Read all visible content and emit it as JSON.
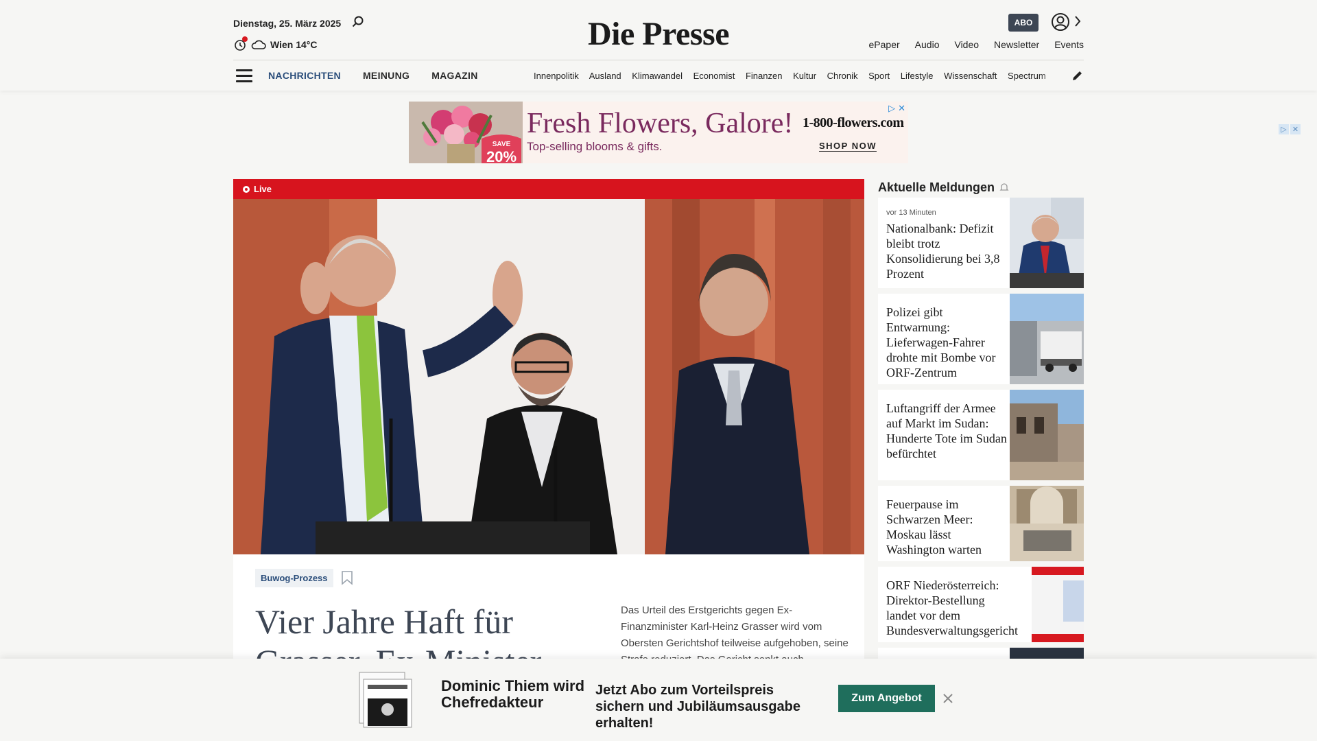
{
  "header": {
    "date": "Dienstag, 25. März 2025",
    "weather": "Wien 14°C",
    "logo": "Die Presse",
    "abo_badge": "ABO",
    "top_links": [
      "ePaper",
      "Audio",
      "Video",
      "Newsletter",
      "Events"
    ],
    "main_nav": [
      "NACHRICHTEN",
      "MEINUNG",
      "MAGAZIN"
    ],
    "sub_nav": [
      "Innenpolitik",
      "Ausland",
      "Klimawandel",
      "Economist",
      "Finanzen",
      "Kultur",
      "Chronik",
      "Sport",
      "Lifestyle",
      "Wissenschaft",
      "Spectrum"
    ]
  },
  "ad": {
    "headline": "Fresh Flowers, Galore!",
    "subline": "Top-selling blooms & gifts.",
    "brand": "1-800-flowers.com",
    "cta": "SHOP NOW",
    "save_label": "SAVE",
    "save_value": "20%"
  },
  "lead": {
    "live_label": "Live",
    "tag": "Buwog-Prozess",
    "headline": "Vier Jahre Haft für Grasser, Ex-Minister",
    "teaser": "Das Urteil des Erstgerichts gegen Ex-Finanzminister Karl-Heinz Grasser wird vom Obersten Gerichtshof teilweise aufgehoben, seine Strafe reduziert. Das Gericht senkt auch"
  },
  "sidebar": {
    "title": "Aktuelle Meldungen",
    "items": [
      {
        "time": "vor 13 Minuten",
        "headline": "Nationalbank: Defizit bleibt trotz Konsolidierung bei 3,8 Prozent"
      },
      {
        "time": "",
        "headline": "Polizei gibt Entwarnung: Lieferwagen-Fahrer drohte mit Bombe vor ORF-Zentrum"
      },
      {
        "time": "",
        "headline": "Luftangriff der Armee auf Markt im Sudan: Hunderte Tote im Sudan befürchtet"
      },
      {
        "time": "",
        "headline": "Feuerpause im Schwarzen Meer: Moskau lässt Washington warten"
      },
      {
        "time": "",
        "headline": "ORF Niederösterreich: Direktor-Bestellung landet vor dem Bundesverwaltungsgericht"
      }
    ]
  },
  "subscription": {
    "title": "Dominic Thiem wird Chefredakteur",
    "offer": "Jetzt Abo zum Vorteilspreis sichern und Jubiläumsausgabe erhalten!",
    "button": "Zum Angebot"
  },
  "colors": {
    "live_red": "#d7141e",
    "nav_active": "#2a4d7a",
    "cta_green": "#1f6e5c",
    "headline_slate": "#3d4654"
  },
  "icons": [
    "search-icon",
    "notification-icon",
    "cloud-icon",
    "user-icon",
    "chevron-right-icon",
    "hamburger-icon",
    "pencil-icon",
    "bookmark-icon",
    "close-icon",
    "ad-choices-icon"
  ]
}
